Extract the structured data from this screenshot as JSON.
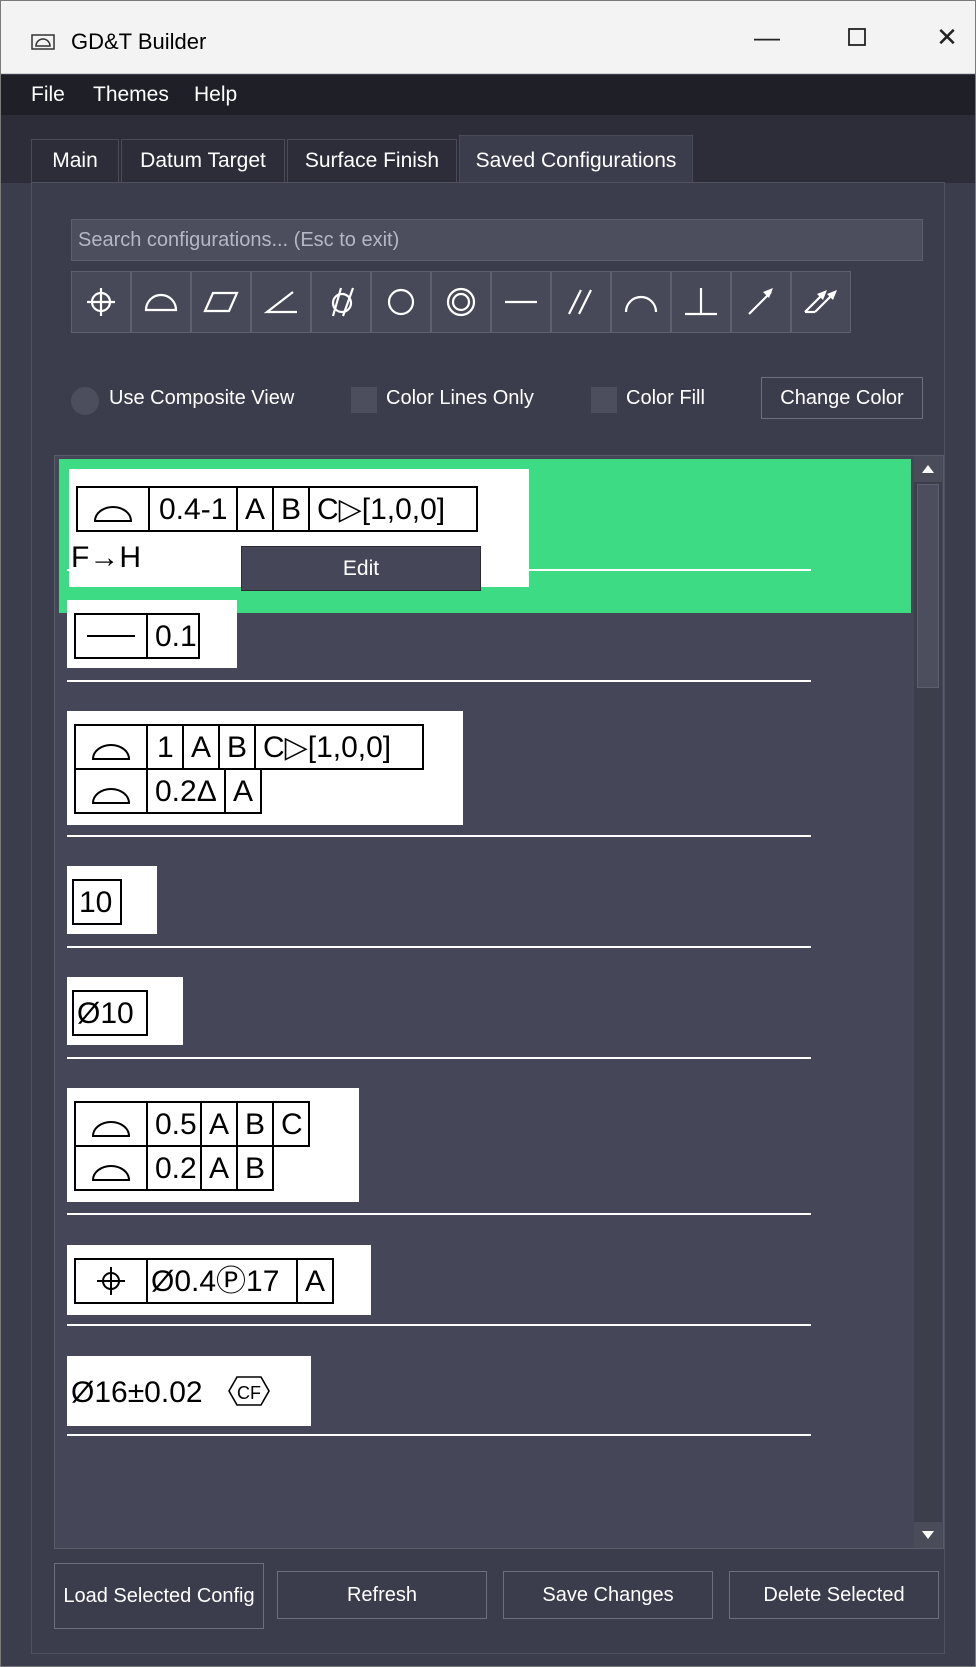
{
  "window": {
    "title": "GD&T Builder"
  },
  "menu": {
    "items": [
      "File",
      "Themes",
      "Help"
    ]
  },
  "tabs": [
    "Main",
    "Datum Target",
    "Surface Finish",
    "Saved Configurations"
  ],
  "search": {
    "placeholder": "Search configurations... (Esc to exit)"
  },
  "symbols": [
    "position-icon",
    "profile-of-surface-icon",
    "flatness-icon",
    "angularity-icon",
    "cylindricity-icon",
    "circularity-icon",
    "concentricity-icon",
    "straightness-icon",
    "parallelism-icon",
    "profile-of-line-icon",
    "perpendicularity-icon",
    "circular-runout-icon",
    "total-runout-icon"
  ],
  "options": {
    "composite": "Use Composite View",
    "lines_only": "Color Lines Only",
    "fill": "Color Fill",
    "change_color": "Change Color"
  },
  "list": {
    "selected_color": "#3ddc84",
    "context_menu": "Edit",
    "items": [
      {
        "cells": [
          "0.4-1",
          "A",
          "B",
          "C▷[1,0,0]"
        ],
        "sub": "F→H"
      },
      {
        "cells": [
          "0.1"
        ]
      },
      {
        "line1": [
          "1",
          "A",
          "B",
          "C▷[1,0,0]"
        ],
        "line2": [
          "0.2Δ",
          "A"
        ]
      },
      {
        "cells": [
          "10"
        ]
      },
      {
        "cells": [
          "Ø10"
        ]
      },
      {
        "line1": [
          "0.5",
          "A",
          "B",
          "C"
        ],
        "line2": [
          "0.2",
          "A",
          "B"
        ]
      },
      {
        "cells": [
          "Ø0.4Ⓟ17",
          "A"
        ]
      },
      {
        "text": "Ø16±0.02",
        "tag": "CF"
      }
    ]
  },
  "buttons": {
    "load": "Load Selected Config",
    "refresh": "Refresh",
    "save": "Save Changes",
    "delete": "Delete Selected"
  }
}
